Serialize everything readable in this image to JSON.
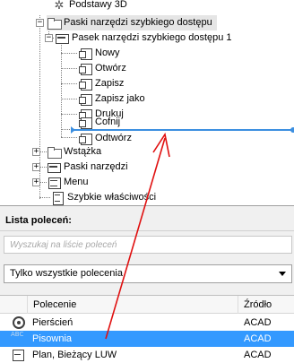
{
  "tree": {
    "items": [
      {
        "label": "Podstawy 3D",
        "icon": "gear-icon"
      },
      {
        "label": "Paski narzędzi szybkiego dostępu",
        "icon": "folder-icon",
        "expander": "−"
      },
      {
        "label": "Pasek narzędzi szybkiego dostępu 1",
        "icon": "toolbar-icon",
        "expander": "−"
      },
      {
        "label": "Nowy",
        "icon": "command-icon"
      },
      {
        "label": "Otwórz",
        "icon": "command-icon"
      },
      {
        "label": "Zapisz",
        "icon": "command-icon"
      },
      {
        "label": "Zapisz jako",
        "icon": "command-icon"
      },
      {
        "label": "Drukuj",
        "icon": "command-icon"
      },
      {
        "label": "Cofnij",
        "icon": "command-icon"
      },
      {
        "label": "Odtwórz",
        "icon": "command-icon"
      },
      {
        "label": "Wstążka",
        "icon": "folder-icon",
        "expander": "+"
      },
      {
        "label": "Paski narzędzi",
        "icon": "toolbar-icon",
        "expander": "+"
      },
      {
        "label": "Menu",
        "icon": "menu-icon",
        "expander": "+"
      },
      {
        "label": "Szybkie właściwości",
        "icon": "properties-icon"
      }
    ]
  },
  "command_list": {
    "title": "Lista poleceń:",
    "search_placeholder": "Wyszukaj na liście poleceń",
    "filter_value": "Tylko wszystkie polecenia",
    "columns": {
      "name": "Polecenie",
      "source": "Źródło"
    },
    "rows": [
      {
        "name": "Pierścień",
        "source": "ACAD",
        "icon": "donut-icon"
      },
      {
        "name": "Pisownia",
        "source": "ACAD",
        "icon": "spelling-icon",
        "selected": true
      },
      {
        "name": "Plan, Bieżący LUW",
        "source": "ACAD",
        "icon": "ucs-plan-icon"
      }
    ]
  },
  "icon_text": {
    "spelling": "ABC"
  },
  "colors": {
    "selection": "#3399ff",
    "drop_indicator": "#3c8fe0",
    "annotation_arrow": "#e01010"
  }
}
